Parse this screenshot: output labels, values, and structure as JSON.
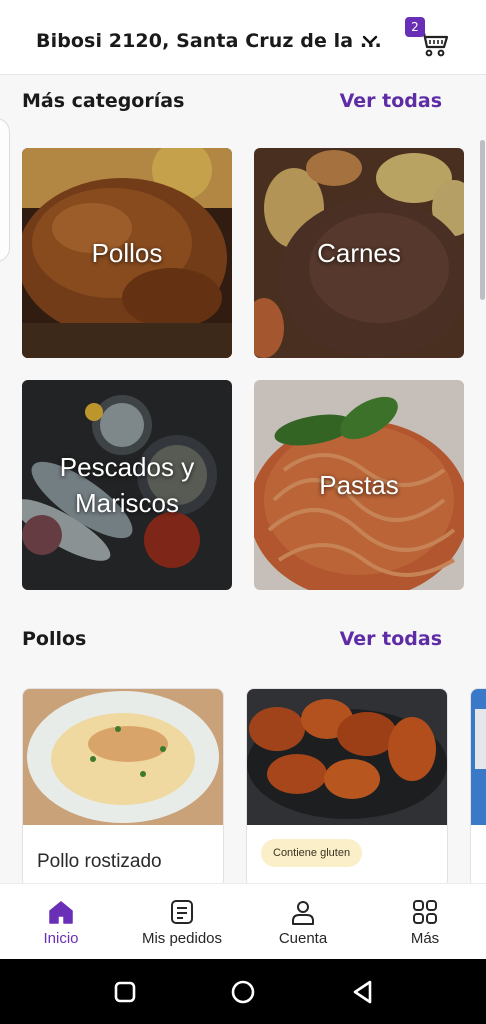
{
  "header": {
    "address": "Bibosi 2120, Santa Cruz de la ...",
    "cart_count": "2",
    "icons": {
      "chevron": "chevron-down-icon",
      "cart": "cart-icon"
    }
  },
  "categories_section": {
    "title": "Más categorías",
    "see_all": "Ver todas",
    "items": [
      {
        "label": "Pollos"
      },
      {
        "label": "Carnes"
      },
      {
        "label": "Pescados y Mariscos"
      },
      {
        "label": "Pastas"
      }
    ]
  },
  "products_section": {
    "title": "Pollos",
    "see_all": "Ver todas",
    "cards": [
      {
        "name": "Pollo rostizado"
      },
      {
        "badge": "Contiene gluten"
      }
    ]
  },
  "bottom_nav": {
    "items": [
      {
        "label": "Inicio",
        "icon": "home-icon",
        "active": true
      },
      {
        "label": "Mis pedidos",
        "icon": "orders-icon",
        "active": false
      },
      {
        "label": "Cuenta",
        "icon": "account-icon",
        "active": false
      },
      {
        "label": "Más",
        "icon": "grid-icon",
        "active": false
      }
    ]
  },
  "colors": {
    "accent": "#6a2fb7",
    "link": "#5e2ca5",
    "badge_bg": "#fbefc9"
  }
}
